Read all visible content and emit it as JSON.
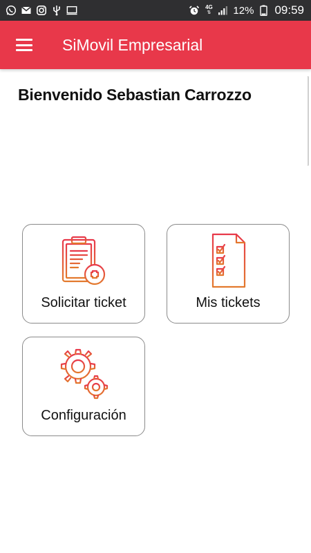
{
  "status_bar": {
    "left_icons": [
      "whatsapp-icon",
      "gmail-icon",
      "instagram-icon",
      "usb-icon",
      "cast-icon"
    ],
    "right_icons": [
      "alarm-icon",
      "4g-icon",
      "signal-icon",
      "battery-icon"
    ],
    "network_label": "4G",
    "battery": "12%",
    "time": "09:59"
  },
  "app_bar": {
    "menu_icon": "hamburger-menu-icon",
    "title": "SiMovil Empresarial",
    "color": "#e8384a"
  },
  "welcome": {
    "greeting": "Bienvenido",
    "user_name": "Sebastian Carrozzo"
  },
  "tiles": [
    {
      "label": "Solicitar ticket",
      "icon": "clipboard-add-icon"
    },
    {
      "label": "Mis tickets",
      "icon": "checklist-icon"
    },
    {
      "label": "Configuración",
      "icon": "gears-icon"
    }
  ],
  "icon_colors": {
    "top": "#e8384a",
    "bottom": "#e3792d"
  }
}
